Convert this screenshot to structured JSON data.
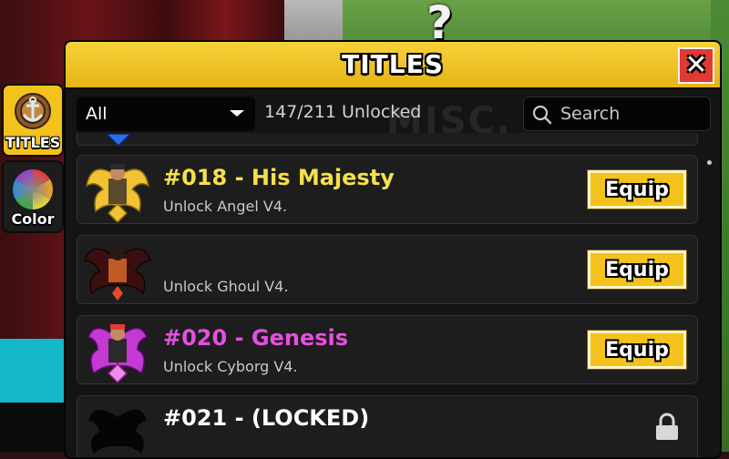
{
  "background": {
    "overlay_text": "?",
    "watermark": "MISC."
  },
  "tabs": [
    {
      "label": "TITLES",
      "icon": "anchor-badge-icon",
      "active": true
    },
    {
      "label": "Color",
      "icon": "color-wheel-icon",
      "active": false
    }
  ],
  "panel": {
    "title": "TITLES",
    "close_label": "✕",
    "filter": {
      "value": "All"
    },
    "unlocked_count": "147/211 Unlocked",
    "search": {
      "placeholder": "Search"
    }
  },
  "titles": [
    {
      "number_title": "#018 - His Majesty",
      "description": "Unlock Angel V4.",
      "title_color": "#f4e04a",
      "button": "Equip",
      "icon": "angel-avatar-icon",
      "locked": false
    },
    {
      "number_title": "#019 - Nightwalker",
      "description": "Unlock Ghoul V4.",
      "title_color": "#1c1c1c",
      "button": "Equip",
      "icon": "ghoul-avatar-icon",
      "locked": false
    },
    {
      "number_title": "#020 - Genesis",
      "description": "Unlock Cyborg V4.",
      "title_color": "#e64fe0",
      "button": "Equip",
      "icon": "cyborg-avatar-icon",
      "locked": false
    },
    {
      "number_title": "#021 - (LOCKED)",
      "description": "",
      "title_color": "#ffffff",
      "button": "",
      "icon": "locked-silhouette-icon",
      "locked": true
    }
  ],
  "colors": {
    "accent": "#f4c21c",
    "close": "#e03a32",
    "panel": "#141414"
  }
}
